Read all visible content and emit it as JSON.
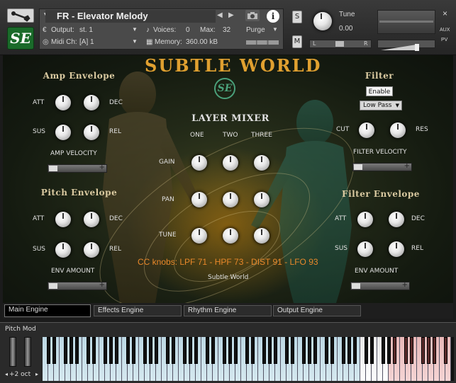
{
  "header": {
    "instrument_name": "FR - Elevator Melody",
    "output_label": "Output:",
    "output_value": "st. 1",
    "midi_label": "Midi Ch:",
    "midi_value": "[A]  1",
    "voices_label": "Voices:",
    "voices_value": "0",
    "max_label": "Max:",
    "max_value": "32",
    "memory_label": "Memory:",
    "memory_value": "360.00 kB",
    "purge_label": "Purge",
    "solo_label": "S",
    "mute_label": "M",
    "tune_label": "Tune",
    "tune_value": "0.00",
    "pan_left": "L",
    "pan_right": "R",
    "aux_label": "AUX",
    "pv_label": "PV",
    "logo_text": "SE",
    "close_label": "×"
  },
  "main": {
    "title": "SUBTLE WORLD",
    "center_logo": "SE",
    "amp_envelope": {
      "title": "Amp Envelope",
      "att": "ATT",
      "dec": "DEC",
      "sus": "SUS",
      "rel": "REL",
      "velocity": "AMP VELOCITY"
    },
    "pitch_envelope": {
      "title": "Pitch Envelope",
      "att": "ATT",
      "dec": "DEC",
      "sus": "SUS",
      "rel": "REL",
      "amount": "ENV AMOUNT"
    },
    "layer_mixer": {
      "title": "LAYER MIXER",
      "one": "ONE",
      "two": "TWO",
      "three": "THREE",
      "gain": "GAIN",
      "pan": "PAN",
      "tune": "TUNE"
    },
    "filter": {
      "title": "Filter",
      "enable": "Enable",
      "mode": "Low Pass",
      "cut": "CUT",
      "res": "RES",
      "velocity": "FILTER VELOCITY"
    },
    "filter_envelope": {
      "title": "Filter Envelope",
      "att": "ATT",
      "dec": "DEC",
      "sus": "SUS",
      "rel": "REL",
      "amount": "ENV AMOUNT"
    },
    "cc_knobs": "CC knobs: LPF 71 - HPF 73 - DIST 91 - LFO 93",
    "footer_name": "Subtle World"
  },
  "tabs": [
    "Main Engine",
    "Effects Engine",
    "Rhythm Engine",
    "Output Engine"
  ],
  "keyboard": {
    "pitch_mod_label": "Pitch Mod",
    "octave_label": "+2 oct"
  },
  "colors": {
    "accent_gold": "#e0a030",
    "cc_orange": "#e8882a",
    "logo_green": "#1a6a2a"
  }
}
